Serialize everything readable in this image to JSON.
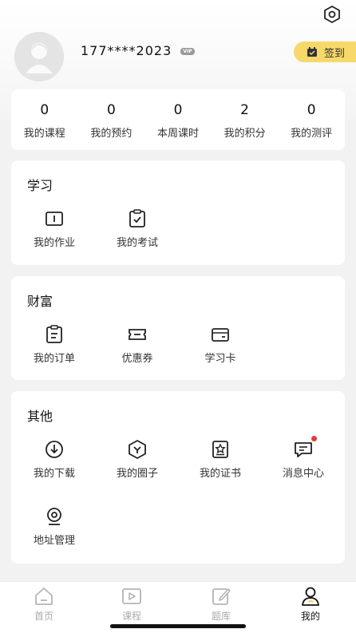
{
  "header": {
    "phone": "177****2023",
    "vip_badge": "VIP",
    "checkin_label": "签到"
  },
  "stats": [
    {
      "value": "0",
      "label": "我的课程"
    },
    {
      "value": "0",
      "label": "我的预约"
    },
    {
      "value": "0",
      "label": "本周课时"
    },
    {
      "value": "2",
      "label": "我的积分"
    },
    {
      "value": "0",
      "label": "我的测评"
    }
  ],
  "study": {
    "title": "学习",
    "items": [
      {
        "label": "我的作业",
        "icon": "book-icon"
      },
      {
        "label": "我的考试",
        "icon": "clipboard-check-icon"
      }
    ]
  },
  "wealth": {
    "title": "财富",
    "items": [
      {
        "label": "我的订单",
        "icon": "order-icon"
      },
      {
        "label": "优惠券",
        "icon": "coupon-icon"
      },
      {
        "label": "学习卡",
        "icon": "card-icon"
      }
    ]
  },
  "other": {
    "title": "其他",
    "items": [
      {
        "label": "我的下载",
        "icon": "download-icon"
      },
      {
        "label": "我的圈子",
        "icon": "circle-icon"
      },
      {
        "label": "我的证书",
        "icon": "certificate-icon"
      },
      {
        "label": "消息中心",
        "icon": "message-icon"
      },
      {
        "label": "地址管理",
        "icon": "location-icon"
      }
    ]
  },
  "tabs": [
    {
      "label": "首页",
      "icon": "home-icon"
    },
    {
      "label": "课程",
      "icon": "play-icon"
    },
    {
      "label": "题库",
      "icon": "edit-icon"
    },
    {
      "label": "我的",
      "icon": "user-icon"
    }
  ],
  "colors": {
    "accent": "#f7d86b",
    "badge_red": "#e53935",
    "icon_stroke": "#222222",
    "inactive_tab": "#aaaaaa"
  }
}
